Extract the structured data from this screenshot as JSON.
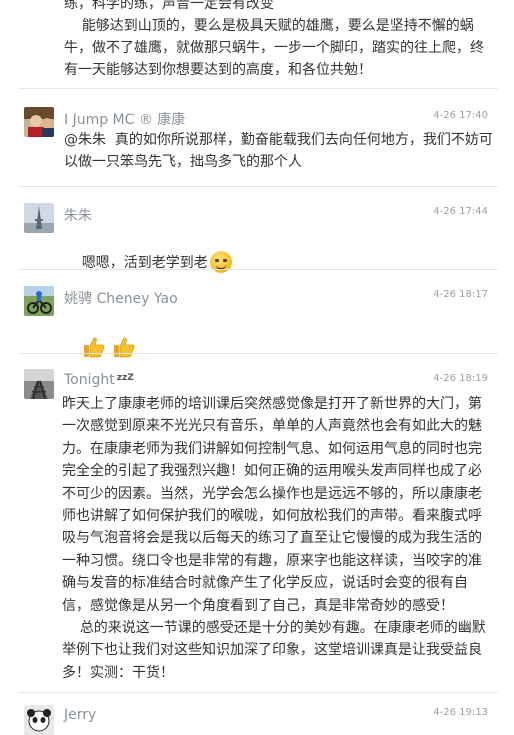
{
  "top_post": {
    "text": "练，科学的练，声音一定会有改变\n    能够达到山顶的，要么是极具天赋的雄鹰，要么是坚持不懈的蜗牛，做不了雄鹰，就做那只蜗牛，一步一个脚印，踏实的往上爬，终有一天能够达到你想要达到的高度，和各位共勉！"
  },
  "comments": [
    {
      "name": "I Jump MC ® 康康",
      "time": "4-26 17:40",
      "text": "@朱朱  真的如你所说那样，勤奋能载我们去向任何地方，我们不妨可以做一只笨鸟先飞，拙鸟多飞的那个人",
      "avatar_icon": "user-avatar-photo"
    },
    {
      "name": "朱朱",
      "time": "4-26 17:44",
      "text": "嗯嗯，活到老学到老",
      "emoji": "thinking-face-emoji",
      "avatar_icon": "eiffel-tower-avatar"
    },
    {
      "name": "姚骋 Cheney Yao",
      "time": "4-26 18:17",
      "emoji": "thumbs-up-emoji",
      "avatar_icon": "cyclist-avatar"
    },
    {
      "name": "Tonight",
      "name_badge": "zzZ",
      "time": "4-26 18:19",
      "text": "昨天上了康康老师的培训课后突然感觉像是打开了新世界的大门，第一次感觉到原来不光光只有音乐，单单的人声竟然也会有如此大的魅力。在康康老师为我们讲解如何控制气息、如何运用气息的同时也完完全全的引起了我强烈兴趣！如何正确的运用喉头发声同样也成了必不可少的因素。当然，光学会怎么操作也是远远不够的，所以康康老师也讲解了如何保护我们的喉咙，如何放松我们的声带。看来腹式呼吸与气泡音将会是我以后每天的练习了直至让它慢慢的成为我生活的一种习惯。绕口令也是非常的有趣，原来字也能这样读，当咬字的准确与发音的标准结合时就像产生了化学反应，说话时会变的很有自信，感觉像是从另一个角度看到了自己，真是非常奇妙的感受！\n    总的来说这一节课的感受还是十分的美妙有趣。在康康老师的幽默举例下也让我们对这些知识加深了印象，这堂培训课真是让我受益良多！实测：干货！",
      "avatar_icon": "railway-avatar"
    },
    {
      "name": "Jerry",
      "time": "4-26 19:13",
      "avatar_icon": "panda-avatar"
    }
  ],
  "colors": {
    "name": "#8a9299",
    "time": "#9aa0a6",
    "text": "#333333",
    "divider": "#e6e6e6"
  }
}
